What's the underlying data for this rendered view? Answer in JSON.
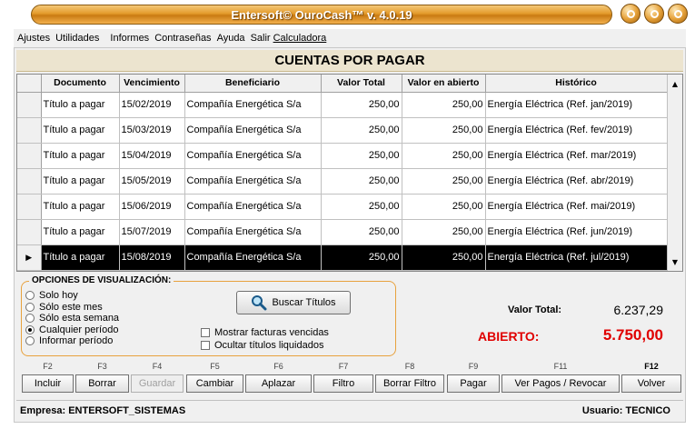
{
  "window": {
    "title": "Entersoft© OuroCash™ v. 4.0.19"
  },
  "menu": [
    "Ajustes",
    "Utilidades",
    "Informes",
    "Contraseñas",
    "Ayuda",
    "Salir",
    "Calculadora"
  ],
  "page_title": "CUENTAS POR PAGAR",
  "table": {
    "columns": [
      "Documento",
      "Vencimiento",
      "Beneficiario",
      "Valor Total",
      "Valor en abierto",
      "Histórico"
    ],
    "rows": [
      [
        "Título a pagar",
        "15/02/2019",
        "Compañía Energética S/a",
        "250,00",
        "250,00",
        "Energía Eléctrica (Ref. jan/2019)"
      ],
      [
        "Título a pagar",
        "15/03/2019",
        "Compañía Energética S/a",
        "250,00",
        "250,00",
        "Energía Eléctrica (Ref. fev/2019)"
      ],
      [
        "Título a pagar",
        "15/04/2019",
        "Compañía Energética S/a",
        "250,00",
        "250,00",
        "Energía Eléctrica (Ref. mar/2019)"
      ],
      [
        "Título a pagar",
        "15/05/2019",
        "Compañía Energética S/a",
        "250,00",
        "250,00",
        "Energía Eléctrica (Ref. abr/2019)"
      ],
      [
        "Título a pagar",
        "15/06/2019",
        "Compañía Energética S/a",
        "250,00",
        "250,00",
        "Energía Eléctrica (Ref. mai/2019)"
      ],
      [
        "Título a pagar",
        "15/07/2019",
        "Compañía Energética S/a",
        "250,00",
        "250,00",
        "Energía Eléctrica (Ref. jun/2019)"
      ],
      [
        "Título a pagar",
        "15/08/2019",
        "Compañía Energética S/a",
        "250,00",
        "250,00",
        "Energía Eléctrica (Ref. jul/2019)"
      ]
    ],
    "selected_row_index": 6,
    "row_indicator": "▶"
  },
  "options": {
    "legend": "OPCIONES DE VISUALIZACIÓN:",
    "radios": [
      {
        "label": "Solo hoy",
        "checked": false
      },
      {
        "label": "Sólo este mes",
        "checked": false
      },
      {
        "label": "Sólo esta semana",
        "checked": false
      },
      {
        "label": "Cualquier período",
        "checked": true
      },
      {
        "label": "Informar período",
        "checked": false
      }
    ],
    "search_button": "Buscar Títulos",
    "checkboxes": [
      {
        "label": "Mostrar facturas vencidas",
        "checked": false
      },
      {
        "label": "Ocultar títulos liquidados",
        "checked": false
      }
    ]
  },
  "totals": {
    "total_label": "Valor Total:",
    "total_value": "6.237,29",
    "open_label": "ABIERTO:",
    "open_value": "5.750,00"
  },
  "function_keys": [
    {
      "key": "F2",
      "label": "Incluir",
      "enabled": true
    },
    {
      "key": "F3",
      "label": "Borrar",
      "enabled": true
    },
    {
      "key": "F4",
      "label": "Guardar",
      "enabled": false
    },
    {
      "key": "F5",
      "label": "Cambiar",
      "enabled": true
    },
    {
      "key": "F6",
      "label": "Aplazar",
      "enabled": true
    },
    {
      "key": "F7",
      "label": "Filtro",
      "enabled": true
    },
    {
      "key": "F8",
      "label": "Borrar Filtro",
      "enabled": true
    },
    {
      "key": "F9",
      "label": "Pagar",
      "enabled": true
    },
    {
      "key": "F11",
      "label": "Ver Pagos / Revocar",
      "enabled": true
    },
    {
      "key": "F12",
      "label": "Volver",
      "enabled": true
    }
  ],
  "status": {
    "company": "Empresa: ENTERSOFT_SISTEMAS",
    "user": "Usuario: TECNICO"
  },
  "colors": {
    "accent_orange": "#e39a2a",
    "open_value_red": "#e00000",
    "selected_row_bg": "#000000"
  }
}
